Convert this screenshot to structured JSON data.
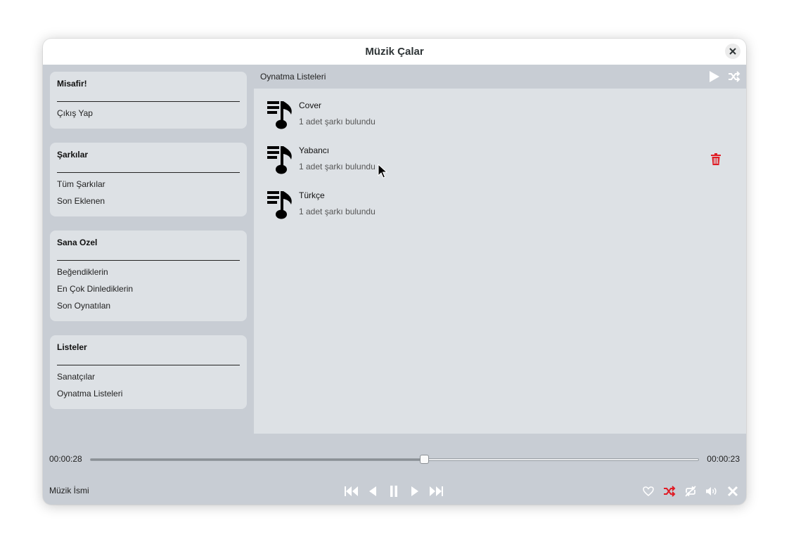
{
  "window": {
    "title": "Müzik Çalar"
  },
  "sidebar": {
    "user": {
      "title": "Misafir!",
      "items": [
        "Çıkış Yap"
      ]
    },
    "songs": {
      "title": "Şarkılar",
      "items": [
        "Tüm Şarkılar",
        "Son Eklenen"
      ]
    },
    "for_you": {
      "title": "Sana Ozel",
      "items": [
        "Beğendiklerin",
        "En Çok Dinlediklerin",
        "Son Oynatılan"
      ]
    },
    "lists": {
      "title": "Listeler",
      "items": [
        "Sanatçılar",
        "Oynatma Listeleri"
      ]
    }
  },
  "main": {
    "header_title": "Oynatma Listeleri",
    "playlists": [
      {
        "name": "Cover",
        "count": "1 adet şarkı bulundu"
      },
      {
        "name": "Yabancı",
        "count": "1 adet şarkı bulundu"
      },
      {
        "name": "Türkçe",
        "count": "1 adet şarkı bulundu"
      }
    ]
  },
  "player": {
    "elapsed": "00:00:28",
    "remaining": "00:00:23",
    "progress": 0.549,
    "song_name": "Müzik İsmi"
  },
  "colors": {
    "accent_red": "#e01b24",
    "icon_white": "#ffffff",
    "icon_dark": "#000000"
  }
}
